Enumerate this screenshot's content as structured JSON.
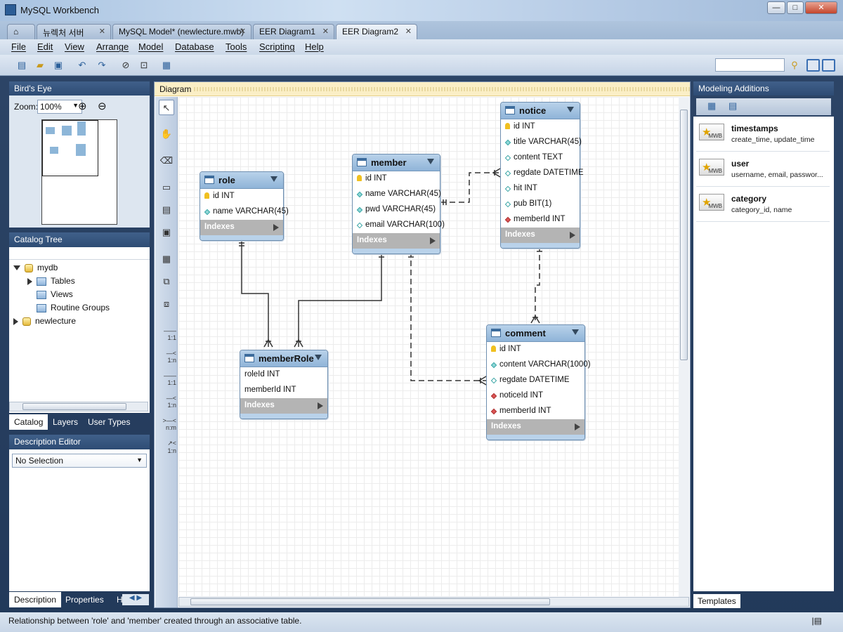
{
  "window": {
    "title": "MySQL Workbench"
  },
  "tabs": [
    {
      "label": "뉴렉처 서버"
    },
    {
      "label": "MySQL Model* (newlecture.mwb)"
    },
    {
      "label": "EER Diagram1"
    },
    {
      "label": "EER Diagram2"
    }
  ],
  "menu": [
    "File",
    "Edit",
    "View",
    "Arrange",
    "Model",
    "Database",
    "Tools",
    "Scripting",
    "Help"
  ],
  "birdeye": {
    "title": "Bird's Eye",
    "zoom_label": "Zoom:",
    "zoom_value": "100%"
  },
  "catalog": {
    "title": "Catalog Tree",
    "items": [
      {
        "label": "mydb"
      },
      {
        "label": "Tables"
      },
      {
        "label": "Views"
      },
      {
        "label": "Routine Groups"
      },
      {
        "label": "newlecture"
      }
    ],
    "tabs": [
      "Catalog",
      "Layers",
      "User Types"
    ]
  },
  "description": {
    "title": "Description Editor",
    "selection": "No Selection",
    "tabs": [
      "Description",
      "Properties",
      "H"
    ]
  },
  "diagram": {
    "title": "Diagram",
    "tool_labels": [
      "1:1",
      "1:n",
      "1:1",
      "1:n",
      "n:m",
      "1:n"
    ],
    "entities": {
      "role": {
        "name": "role",
        "columns": [
          "id INT",
          "name VARCHAR(45)"
        ],
        "indexes": "Indexes"
      },
      "member": {
        "name": "member",
        "columns": [
          "id INT",
          "name VARCHAR(45)",
          "pwd VARCHAR(45)",
          "email VARCHAR(100)"
        ],
        "indexes": "Indexes"
      },
      "notice": {
        "name": "notice",
        "columns": [
          "id INT",
          "title VARCHAR(45)",
          "content TEXT",
          "regdate DATETIME",
          "hit INT",
          "pub BIT(1)",
          "memberId INT"
        ],
        "indexes": "Indexes"
      },
      "memberRole": {
        "name": "memberRole",
        "columns": [
          "roleId INT",
          "memberId INT"
        ],
        "indexes": "Indexes"
      },
      "comment": {
        "name": "comment",
        "columns": [
          "id INT",
          "content VARCHAR(1000)",
          "regdate DATETIME",
          "noticeId INT",
          "memberId INT"
        ],
        "indexes": "Indexes"
      }
    }
  },
  "modeling": {
    "title": "Modeling Additions",
    "templates": [
      {
        "name": "timestamps",
        "desc": "create_time, update_time",
        "badge": "MWB"
      },
      {
        "name": "user",
        "desc": "username, email, passwor...",
        "badge": "MWB"
      },
      {
        "name": "category",
        "desc": "category_id, name",
        "badge": "MWB"
      }
    ],
    "tab": "Templates"
  },
  "status": "Relationship between 'role' and 'member' created through an associative table."
}
